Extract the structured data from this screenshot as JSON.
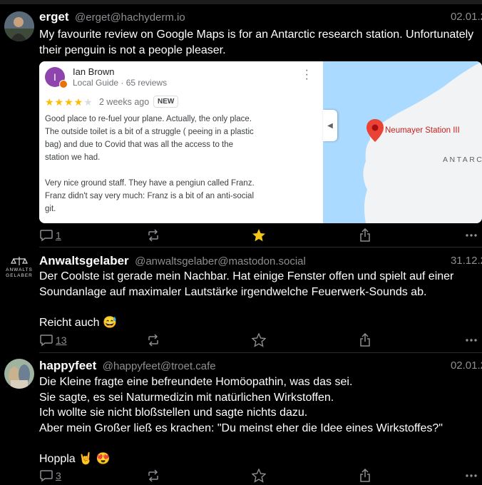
{
  "posts": [
    {
      "author": "erget",
      "handle": "@erget@hachyderm.io",
      "date": "02.01.2",
      "lines": [
        "My favourite review on Google Maps is for an Antarctic research station. Unfortunately",
        "their penguin is not a people pleaser."
      ],
      "card": {
        "reviewer_initial": "I",
        "reviewer_name": "Ian Brown",
        "reviewer_sub": "Local Guide · 65 reviews",
        "rating": 4,
        "when": "2 weeks ago",
        "badge": "NEW",
        "review_lines": [
          "Good place to re-fuel your plane. Actually, the only place.",
          "The outside toilet is a bit of a struggle ( peeing in a plastic",
          "bag) and due to Covid that was all the access to the",
          "station we had.",
          "",
          "Very nice ground staff. They have a pengiun called Franz.",
          "Franz didn't say very much: Franz is a bit of an anti-social",
          "git."
        ],
        "map_place": "Neumayer Station III",
        "map_region": "ANTARCTICA"
      },
      "replies": "1",
      "favourited": true
    },
    {
      "author": "Anwaltsgelaber",
      "handle": "@anwaltsgelaber@mastodon.social",
      "date": "31.12.2",
      "avatar_text": [
        "ANWALTS",
        "GELABER"
      ],
      "lines": [
        "Der Coolste ist gerade mein Nachbar. Hat einige Fenster offen und spielt auf einer",
        "Soundanlage auf maximaler Lautstärke irgendwelche Feuerwerk-Sounds ab.",
        "",
        "Reicht auch 😅"
      ],
      "replies": "13",
      "favourited": false
    },
    {
      "author": "happyfeet",
      "handle": "@happyfeet@troet.cafe",
      "date": "02.01.2",
      "lines": [
        "Die Kleine fragte eine befreundete Homöopathin, was das sei.",
        "Sie sagte, es sei Naturmedizin mit natürlichen Wirkstoffen.",
        "Ich wollte sie nicht bloßstellen und sagte nichts dazu.",
        "Aber mein Großer ließ es krachen: \"Du meinst eher die Idee eines Wirkstoffes?\"",
        "",
        "Hoppla 🤘 😍"
      ],
      "replies": "3",
      "favourited": false
    }
  ],
  "colors": {
    "star_active": "#f5c518",
    "muted": "#8e8e93",
    "map_water": "#aadaff",
    "pin": "#ea4335"
  },
  "icons": {
    "reply": "reply-icon",
    "boost": "boost-icon",
    "favourite": "star-icon",
    "share": "share-icon",
    "more": "more-icon"
  }
}
